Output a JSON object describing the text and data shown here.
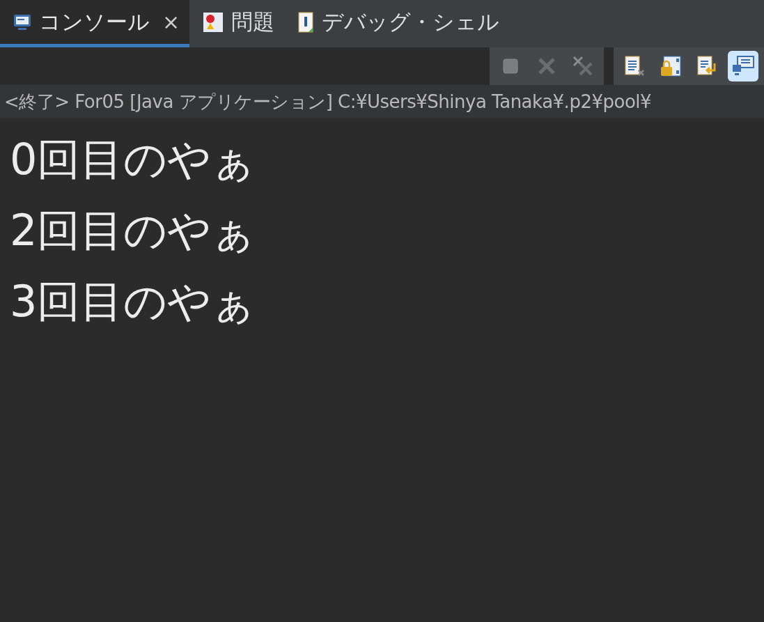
{
  "tabs": [
    {
      "label": "コンソール",
      "selected": true,
      "close": "×",
      "kind": "console"
    },
    {
      "label": "問題",
      "selected": false,
      "kind": "problems"
    },
    {
      "label": "デバッグ・シェル",
      "selected": false,
      "kind": "shell"
    }
  ],
  "toolbar": {
    "groups": [
      [
        {
          "kind": "terminate",
          "disabled": true,
          "selected": false
        },
        {
          "kind": "remove",
          "disabled": true,
          "selected": false
        },
        {
          "kind": "removeall",
          "disabled": true,
          "selected": false
        }
      ],
      [
        {
          "kind": "clear",
          "disabled": false,
          "selected": false
        },
        {
          "kind": "lock",
          "disabled": false,
          "selected": false
        },
        {
          "kind": "wrap",
          "disabled": false,
          "selected": false
        },
        {
          "kind": "pin",
          "disabled": false,
          "selected": true
        }
      ]
    ]
  },
  "process_label": "<終了> For05 [Java アプリケーション] C:¥Users¥Shinya Tanaka¥.p2¥pool¥",
  "output_lines": [
    "0回目のやぁ",
    "2回目のやぁ",
    "3回目のやぁ"
  ]
}
